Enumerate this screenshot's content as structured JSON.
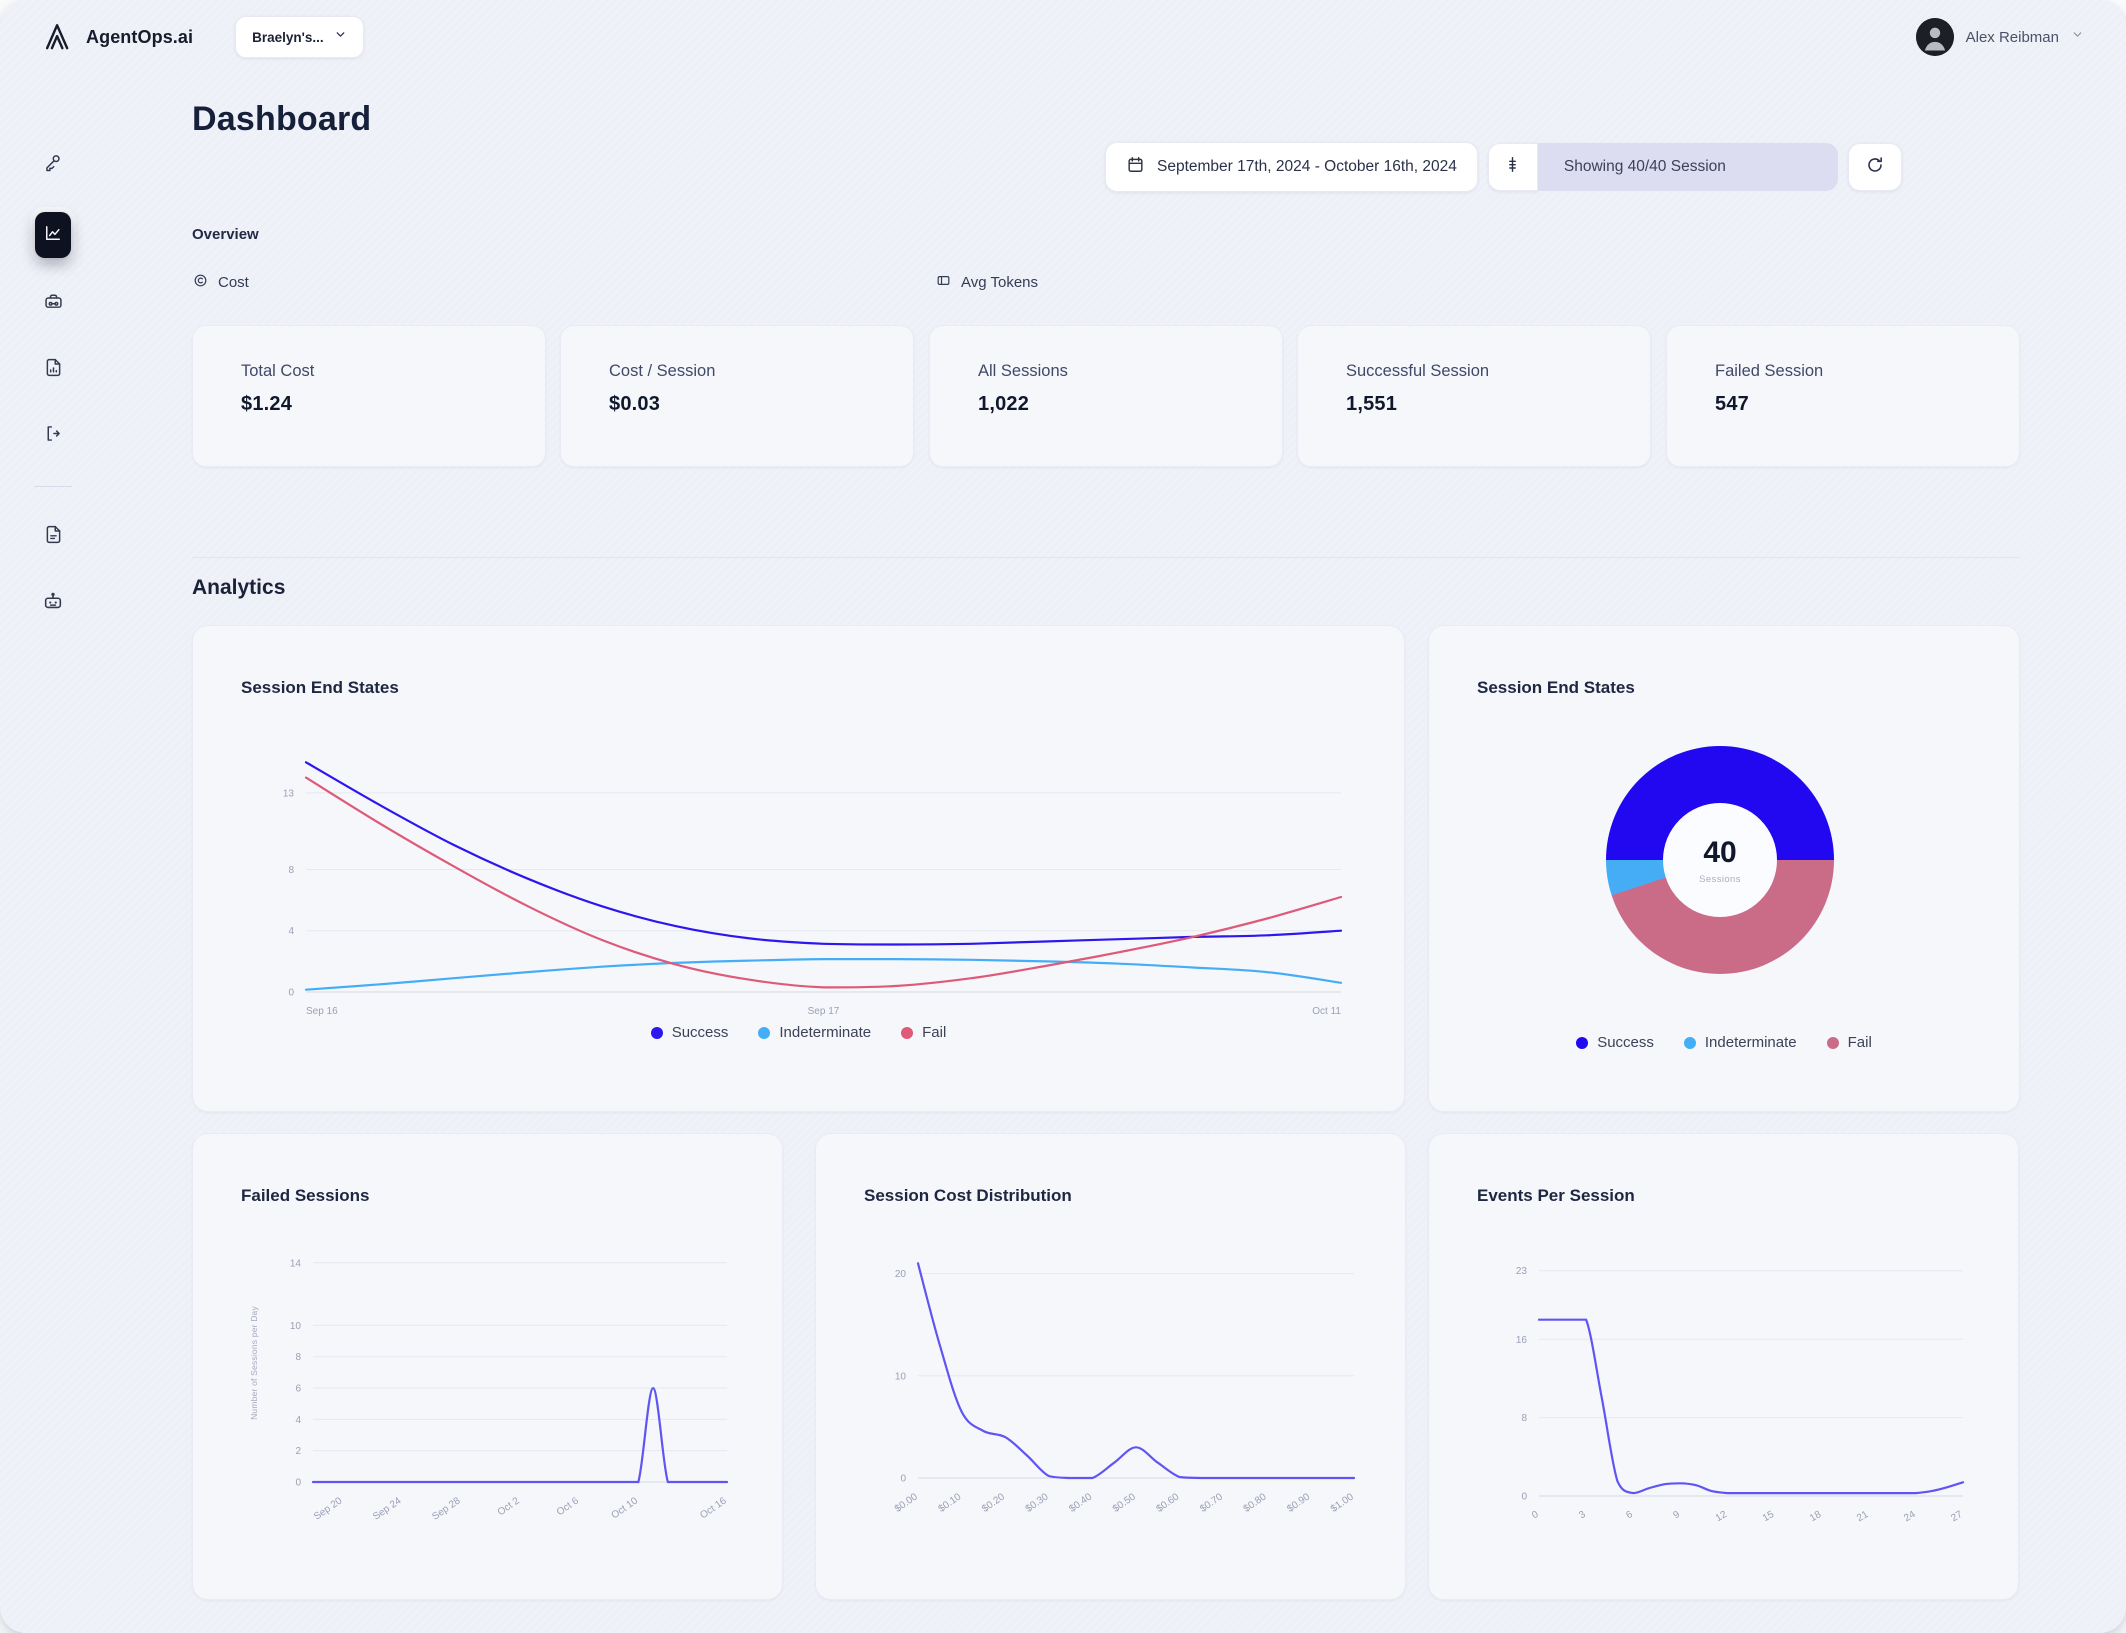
{
  "app": {
    "brand": "AgentOps.ai",
    "workspace": "Braelyn's...",
    "user": "Alex Reibman"
  },
  "header": {
    "title": "Dashboard",
    "date_range": "September 17th, 2024 - October 16th, 2024",
    "showing": "Showing 40/40 Session"
  },
  "sidebar": {
    "items": [
      {
        "icon": "key-icon",
        "active": false
      },
      {
        "icon": "chart-line-icon",
        "active": true
      },
      {
        "icon": "bot-case-icon",
        "active": false
      },
      {
        "icon": "file-chart-icon",
        "active": false
      },
      {
        "icon": "code-bracket-icon",
        "active": false
      },
      {
        "icon": "document-icon",
        "active": false
      },
      {
        "icon": "robot-icon",
        "active": false
      }
    ]
  },
  "overview": {
    "label": "Overview",
    "cost_tab": "Cost",
    "tokens_tab": "Avg Tokens",
    "cards": [
      {
        "label": "Total Cost",
        "value": "$1.24"
      },
      {
        "label": "Cost / Session",
        "value": "$0.03"
      },
      {
        "label": "All Sessions",
        "value": "1,022"
      },
      {
        "label": "Successful Session",
        "value": "1,551"
      },
      {
        "label": "Failed Session",
        "value": "547"
      }
    ]
  },
  "analytics": {
    "label": "Analytics"
  },
  "colors": {
    "success": "#2d16ee",
    "indeterminate": "#45adf5",
    "fail_line": "#dd5a78",
    "fail_donut": "#ca6c87",
    "indigo_line": "#5f55f2",
    "active_nav": "#0e1220",
    "showing_pill": "#dcddf1"
  },
  "chart_data": [
    {
      "type": "line",
      "title": "Session End States",
      "x_labels": [
        "Sep 16",
        "Sep 17",
        "Oct 11"
      ],
      "yticks": [
        0,
        4,
        8,
        13
      ],
      "ymax": 15.8,
      "series": [
        {
          "name": "Success",
          "color": "#2d16ee",
          "values": [
            15,
            12.2,
            9.6,
            7.4,
            5.6,
            4.3,
            3.5,
            3.15,
            3.1,
            3.15,
            3.3,
            3.45,
            3.6,
            3.7,
            4.0
          ]
        },
        {
          "name": "Indeterminate",
          "color": "#45adf5",
          "values": [
            0.15,
            0.5,
            0.9,
            1.3,
            1.65,
            1.9,
            2.05,
            2.15,
            2.15,
            2.1,
            2.0,
            1.85,
            1.6,
            1.3,
            0.6
          ]
        },
        {
          "name": "Fail",
          "color": "#dd5a78",
          "values": [
            14,
            11,
            8.2,
            5.6,
            3.4,
            1.8,
            0.8,
            0.3,
            0.4,
            0.9,
            1.7,
            2.6,
            3.6,
            4.8,
            6.2
          ]
        }
      ],
      "legend": [
        {
          "label": "Success",
          "color": "#2d16ee"
        },
        {
          "label": "Indeterminate",
          "color": "#45adf5"
        },
        {
          "label": "Fail",
          "color": "#dd5a78"
        }
      ]
    },
    {
      "type": "donut",
      "title": "Session End States",
      "center_value": "40",
      "center_label": "Sessions",
      "slices": [
        {
          "name": "Success",
          "value": 20,
          "color": "#2208f0"
        },
        {
          "name": "Fail",
          "value": 18,
          "color": "#ca6c87"
        },
        {
          "name": "Indeterminate",
          "value": 2,
          "color": "#45adf5"
        }
      ],
      "legend": [
        {
          "label": "Success",
          "color": "#2208f0"
        },
        {
          "label": "Indeterminate",
          "color": "#45adf5"
        },
        {
          "label": "Fail",
          "color": "#ca6c87"
        }
      ]
    },
    {
      "type": "line",
      "title": "Failed Sessions",
      "ylabel": "Number of Sessions per Day",
      "yticks": [
        0,
        2,
        4,
        6,
        8,
        10,
        14
      ],
      "ymax": 15.2,
      "x_tick_labels": [
        "Sep 20",
        "Sep 24",
        "Sep 28",
        "Oct 2",
        "Oct 6",
        "Oct 10",
        "Oct 16"
      ],
      "x_tick_idx": [
        2,
        6,
        10,
        14,
        18,
        22,
        28
      ],
      "series": [
        {
          "name": "Failed Sessions",
          "color": "#5f55f2",
          "values": [
            0,
            0,
            0,
            0,
            0,
            0,
            0,
            0,
            0,
            0,
            0,
            0,
            0,
            0,
            0,
            0,
            0,
            0,
            0,
            0,
            0,
            0,
            0,
            6,
            0,
            0,
            0,
            0,
            0
          ]
        }
      ]
    },
    {
      "type": "line",
      "title": "Session Cost Distribution",
      "yticks": [
        0,
        10,
        20
      ],
      "ymax": 22.5,
      "x_tick_labels": [
        "$0.00",
        "$0.10",
        "$0.20",
        "$0.30",
        "$0.40",
        "$0.50",
        "$0.60",
        "$0.70",
        "$0.80",
        "$0.90",
        "$1.00"
      ],
      "x_tick_idx": [
        0,
        2,
        4,
        6,
        8,
        10,
        12,
        14,
        16,
        18,
        20
      ],
      "series": [
        {
          "name": "Sessions",
          "color": "#5f55f2",
          "values": [
            21,
            13,
            6.5,
            4.6,
            4.0,
            2.2,
            0.2,
            0,
            0,
            1.5,
            3,
            1.5,
            0.1,
            0,
            0,
            0,
            0,
            0,
            0,
            0,
            0
          ]
        }
      ]
    },
    {
      "type": "line",
      "title": "Events Per Session",
      "yticks": [
        0,
        8,
        16,
        23
      ],
      "ymax": 24.5,
      "x_tick_labels": [
        "0",
        "3",
        "6",
        "9",
        "12",
        "15",
        "18",
        "21",
        "24",
        "27"
      ],
      "x_tick_idx": [
        0,
        3,
        6,
        9,
        12,
        15,
        18,
        21,
        24,
        27
      ],
      "series": [
        {
          "name": "Events",
          "color": "#5f55f2",
          "values": [
            18,
            18,
            18,
            18,
            10,
            1.5,
            0.3,
            0.8,
            1.2,
            1.3,
            1.1,
            0.5,
            0.3,
            0.3,
            0.3,
            0.3,
            0.3,
            0.3,
            0.3,
            0.3,
            0.3,
            0.3,
            0.3,
            0.3,
            0.3,
            0.5,
            0.9,
            1.4
          ]
        }
      ]
    }
  ]
}
